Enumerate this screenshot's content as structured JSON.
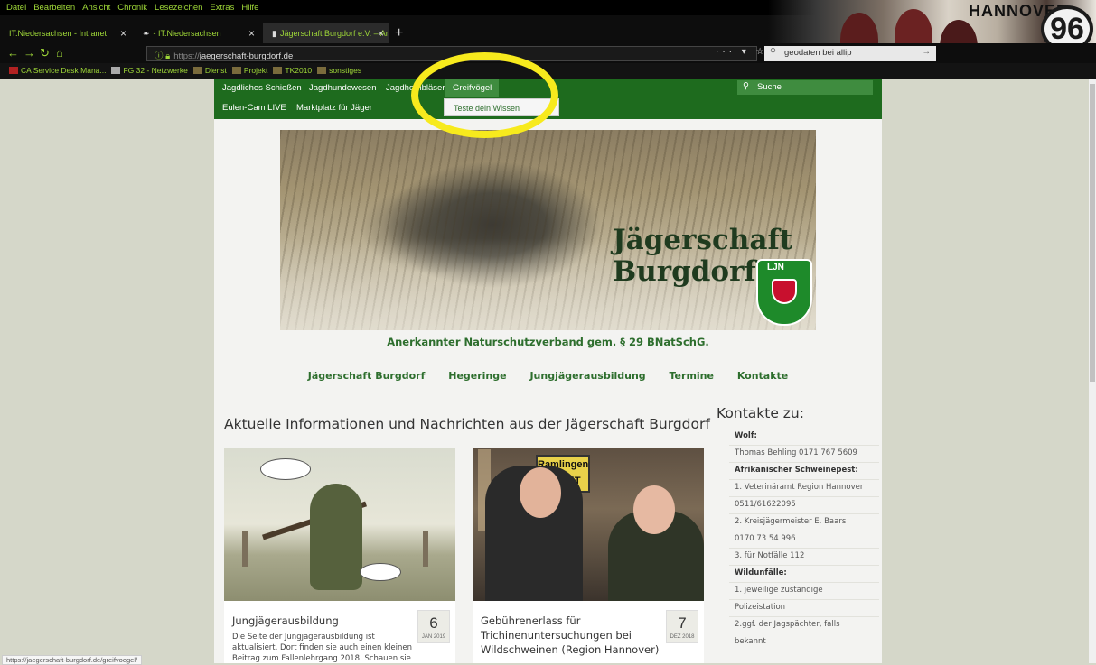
{
  "browser": {
    "menu": [
      "Datei",
      "Bearbeiten",
      "Ansicht",
      "Chronik",
      "Lesezeichen",
      "Extras",
      "Hilfe"
    ],
    "tabs": [
      {
        "label": "IT.Niedersachsen - Intranet",
        "active": false
      },
      {
        "label": "- IT.Niedersachsen",
        "active": false
      },
      {
        "label": "Jägerschaft Burgdorf e.V. – Arb",
        "active": true
      }
    ],
    "new_tab": "+",
    "url_prefix": "https://",
    "url_host": "jaegerschaft-burgdorf.de",
    "url_actions": "··· ▾ ☆",
    "search_value": "geodaten bei allip",
    "bookmarks": [
      "CA Service Desk Mana...",
      "FG 32 - Netzwerke",
      "Dienst",
      "Projekt",
      "TK2010",
      "sonstiges"
    ],
    "banner_text": "HANNOVER",
    "banner_logo": "96",
    "status_url": "https://jaegerschaft-burgdorf.de/greifvoegel/"
  },
  "site": {
    "nav": {
      "row1": [
        "Jagdliches Schießen",
        "Jagdhundewesen",
        "Jagdhornbläser",
        "Greifvögel"
      ],
      "row2": [
        "Eulen-Cam LIVE",
        "Marktplatz für Jäger"
      ],
      "active": "Greifvögel",
      "dropdown_item": "Teste dein Wissen",
      "search_label": "Suche"
    },
    "hero": {
      "title_line1": "Jägerschaft",
      "title_line2": "Burgdorf",
      "crest_label": "LJN"
    },
    "tagline": "Anerkannter Naturschutzverband gem. § 29 BNatSchG.",
    "main_nav": [
      "Jägerschaft Burgdorf",
      "Hegeringe",
      "Jungjägerausbildung",
      "Termine",
      "Kontakte"
    ],
    "heading": "Aktuelle Informationen und Nachrichten aus der Jägerschaft Burgdorf",
    "cards": [
      {
        "title": "Jungjägerausbildung",
        "day": "6",
        "month": "JAN 2019",
        "body": "Die Seite der Jungjägerausbildung ist aktualisiert. Dort finden sie auch einen kleinen Beitrag zum Fallenlehrgang 2018. Schauen sie"
      },
      {
        "title": "Gebührenerlass für Trichinenuntersuchungen bei Wildschweinen (Region Hannover)",
        "day": "7",
        "month": "DEZ 2018",
        "sign": "Ramlingen ROCKT"
      }
    ],
    "sidebar": {
      "title": "Kontakte zu:",
      "rows": [
        {
          "text": "Wolf:",
          "bold": true
        },
        {
          "text": "Thomas Behling 0171 767 5609",
          "bold": false
        },
        {
          "text": "Afrikanischer Schweinepest:",
          "bold": true
        },
        {
          "text": "1. Veterinäramt Region Hannover",
          "bold": false
        },
        {
          "text": "0511/61622095",
          "bold": false
        },
        {
          "text": "2. Kreisjägermeister E. Baars",
          "bold": false
        },
        {
          "text": "0170 73 54 996",
          "bold": false
        },
        {
          "text": "3. für Notfälle 112",
          "bold": false
        },
        {
          "text": "Wildunfälle:",
          "bold": true
        },
        {
          "text": "1. jeweilige zuständige",
          "bold": false
        },
        {
          "text": "Polizeistation",
          "bold": false
        },
        {
          "text": "2.ggf. der Jagspächter, falls",
          "bold": false
        },
        {
          "text": "bekannt",
          "bold": false
        }
      ]
    }
  },
  "colors": {
    "site_green": "#1e6b1e",
    "text_green": "#2d6e2d",
    "browser_accent": "#9fd838",
    "highlight_ring": "#f7ea1d"
  }
}
